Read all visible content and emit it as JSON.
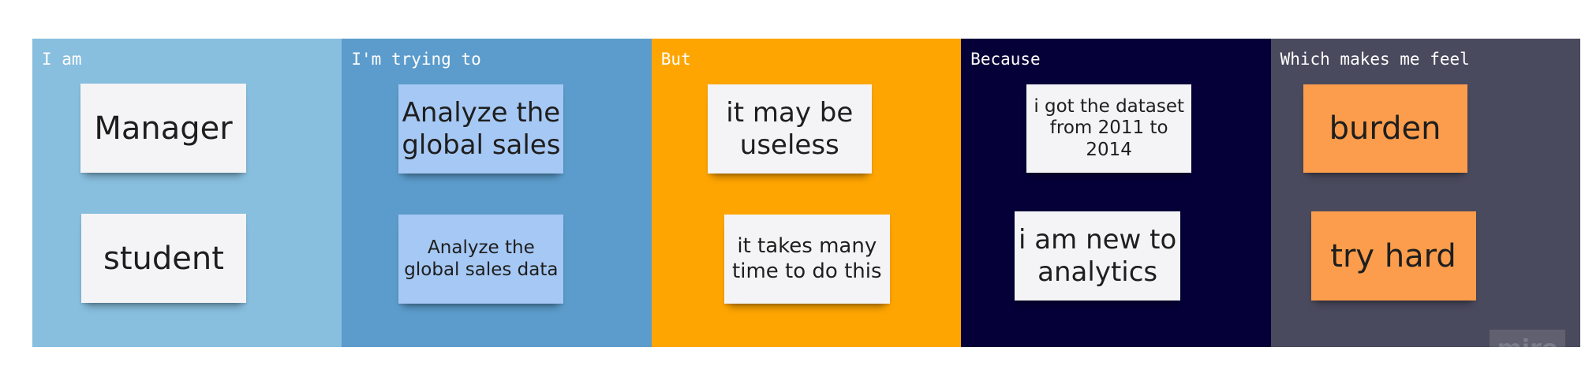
{
  "columns": [
    {
      "title": "I am",
      "color": "#88bede",
      "notes": [
        "Manager",
        "student"
      ]
    },
    {
      "title": "I'm trying to",
      "color": "#5c9ccc",
      "notes": [
        "Analyze the global sales",
        "Analyze the global sales data"
      ]
    },
    {
      "title": "But",
      "color": "#fea502",
      "notes": [
        "it may be useless",
        "it takes many time to do this"
      ]
    },
    {
      "title": "Because",
      "color": "#050038",
      "notes": [
        "i got the dataset from 2011 to 2014",
        "i am new to analytics"
      ]
    },
    {
      "title": "Which makes me feel",
      "color": "#4a4a5e",
      "notes": [
        "burden",
        "try hard"
      ]
    }
  ],
  "note_colors": {
    "white": "#f4f4f6",
    "blue": "#a6c8f4",
    "orange": "#fb9d4c"
  },
  "watermark": "miro"
}
